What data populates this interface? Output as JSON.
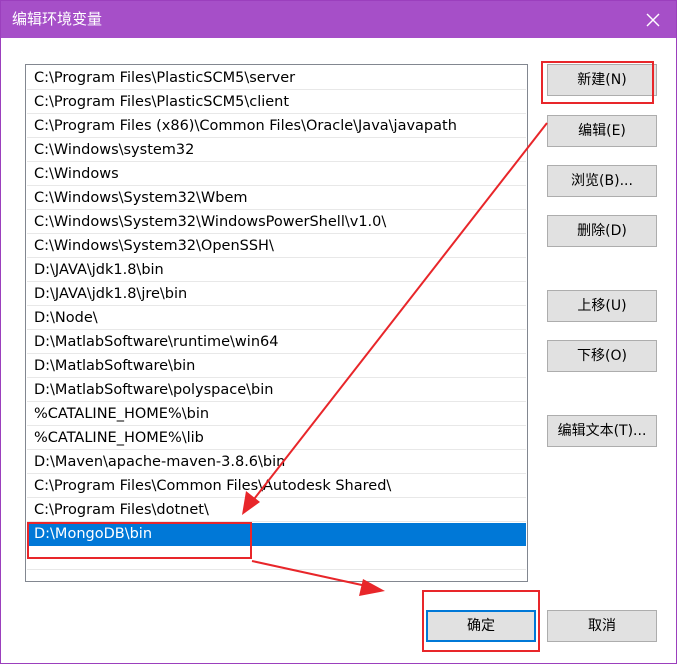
{
  "window": {
    "title": "编辑环境变量",
    "close_glyph": "✕"
  },
  "path_list": {
    "items": [
      "C:\\Program Files\\PlasticSCM5\\server",
      "C:\\Program Files\\PlasticSCM5\\client",
      "C:\\Program Files (x86)\\Common Files\\Oracle\\Java\\javapath",
      "C:\\Windows\\system32",
      "C:\\Windows",
      "C:\\Windows\\System32\\Wbem",
      "C:\\Windows\\System32\\WindowsPowerShell\\v1.0\\",
      "C:\\Windows\\System32\\OpenSSH\\",
      "D:\\JAVA\\jdk1.8\\bin",
      "D:\\JAVA\\jdk1.8\\jre\\bin",
      "D:\\Node\\",
      "D:\\MatlabSoftware\\runtime\\win64",
      "D:\\MatlabSoftware\\bin",
      "D:\\MatlabSoftware\\polyspace\\bin",
      "%CATALINE_HOME%\\bin",
      "%CATALINE_HOME%\\lib",
      "D:\\Maven\\apache-maven-3.8.6\\bin",
      "C:\\Program Files\\Common Files\\Autodesk Shared\\",
      "C:\\Program Files\\dotnet\\",
      "D:\\MongoDB\\bin"
    ],
    "selected_index": 19
  },
  "buttons": {
    "new": "新建(N)",
    "edit": "编辑(E)",
    "browse": "浏览(B)...",
    "delete": "删除(D)",
    "move_up": "上移(U)",
    "move_down": "下移(O)",
    "edit_text": "编辑文本(T)...",
    "ok": "确定",
    "cancel": "取消"
  },
  "colors": {
    "titlebar": "#a64fc8",
    "selection": "#0078d7",
    "annotation": "#e8262a"
  }
}
